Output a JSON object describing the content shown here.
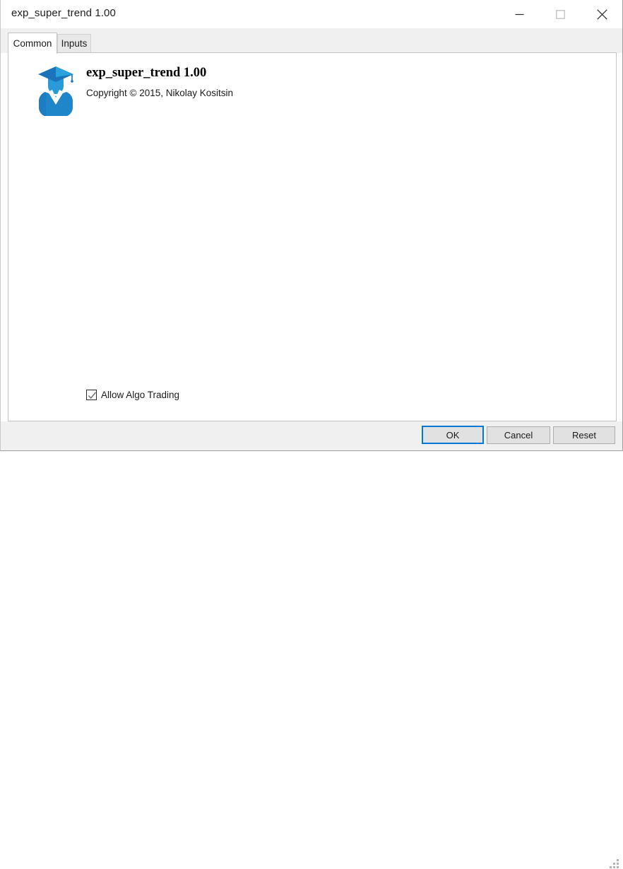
{
  "window": {
    "title": "exp_super_trend 1.00",
    "controls": {
      "minimize": "minimize-button",
      "maximize": "maximize-button",
      "close": "close-button"
    }
  },
  "tabs": [
    {
      "label": "Common",
      "active": true
    },
    {
      "label": "Inputs",
      "active": false
    }
  ],
  "common_tab": {
    "icon": "graduate-cap-avatar-icon",
    "product_title": "exp_super_trend 1.00",
    "copyright": "Copyright © 2015, Nikolay Kositsin",
    "algo_trading": {
      "label": "Allow Algo Trading",
      "checked": true
    }
  },
  "footer": {
    "ok_label": "OK",
    "cancel_label": "Cancel",
    "reset_label": "Reset"
  },
  "colors": {
    "accent_focus": "#0078d7",
    "icon_blue_dark": "#1b74bb",
    "icon_blue_mid": "#2196d6",
    "icon_blue_light": "#34b3e8",
    "titlebar_bg": "#ffffff",
    "chrome_bg": "#f0f0f0",
    "content_bg": "#ffffff",
    "button_bg": "#e1e1e1",
    "border": "#c4c4c4"
  }
}
